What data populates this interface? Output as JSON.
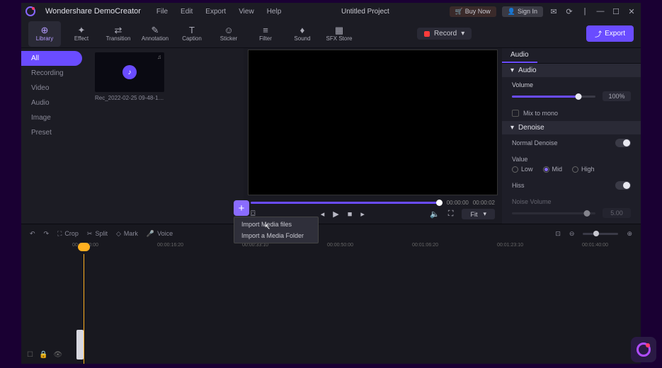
{
  "app_name": "Wondershare DemoCreator",
  "menus": [
    "File",
    "Edit",
    "Export",
    "View",
    "Help"
  ],
  "project_title": "Untitled Project",
  "buy_now": "Buy Now",
  "sign_in": "Sign In",
  "tools": [
    {
      "icon": "⊕",
      "label": "Library"
    },
    {
      "icon": "✦",
      "label": "Effect"
    },
    {
      "icon": "⇄",
      "label": "Transition"
    },
    {
      "icon": "✎",
      "label": "Annotation"
    },
    {
      "icon": "T",
      "label": "Caption"
    },
    {
      "icon": "☺",
      "label": "Sticker"
    },
    {
      "icon": "≡",
      "label": "Filter"
    },
    {
      "icon": "♦",
      "label": "Sound"
    },
    {
      "icon": "▦",
      "label": "SFX Store"
    }
  ],
  "record_label": "Record",
  "export_label": "Export",
  "sidebar": [
    "All",
    "Recording",
    "Video",
    "Audio",
    "Image",
    "Preset"
  ],
  "clip_name": "Rec_2022-02-25 09-48-12...",
  "time_cur": "00:00:00",
  "time_total": "00:00:02",
  "fit_label": "Fit",
  "rpanel": {
    "tab": "Audio",
    "audio": "Audio",
    "volume": "Volume",
    "volume_val": "100%",
    "mix": "Mix to mono",
    "denoise": "Denoise",
    "normal": "Normal Denoise",
    "value": "Value",
    "low": "Low",
    "mid": "Mid",
    "high": "High",
    "hiss": "Hiss",
    "noise_vol": "Noise Volume",
    "noise_val": "5.00"
  },
  "tl_tools": {
    "crop": "Crop",
    "split": "Split",
    "mark": "Mark",
    "voice": "Voice"
  },
  "ruler": [
    "00:00:00:00",
    "00:00:16:20",
    "00:00:33:10",
    "00:00:50:00",
    "00:01:06:20",
    "00:01:23:10",
    "00:01:40:00"
  ],
  "ctx": {
    "files": "Import Media files",
    "folder": "Import a Media Folder"
  }
}
